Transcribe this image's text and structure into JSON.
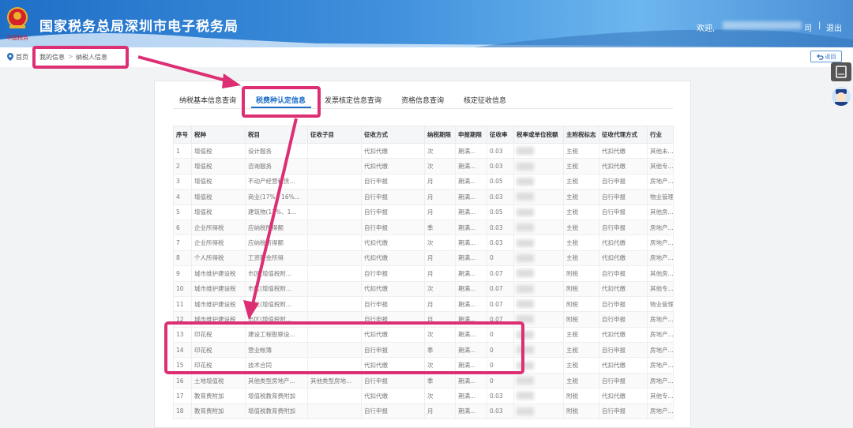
{
  "header": {
    "title": "国家税务总局深圳市电子税务局",
    "welcome": "欢迎,",
    "user_suffix": "司",
    "separator": "|",
    "logout": "退出",
    "logo_text": "中国税务"
  },
  "breadcrumb": {
    "home": "首页",
    "items": [
      "我的信息",
      "纳税人信息"
    ],
    "separator": ">"
  },
  "back_label": "返回",
  "tabs": [
    {
      "label": "纳税基本信息查询"
    },
    {
      "label": "税费种认定信息"
    },
    {
      "label": "发票核定信息查询"
    },
    {
      "label": "资格信息查询"
    },
    {
      "label": "核定征收信息"
    }
  ],
  "table": {
    "headers": [
      "序号",
      "税种",
      "税目",
      "征收子目",
      "征收方式",
      "纳税期限",
      "申报期限",
      "征收率",
      "税率或单位税额",
      "主附税标志",
      "征收代理方式",
      "行业"
    ],
    "rows": [
      [
        "1",
        "增值税",
        "设计服务",
        "",
        "代扣代缴",
        "次",
        "期满...",
        "0.03",
        "",
        "主税",
        "代扣代缴",
        "其他未..."
      ],
      [
        "2",
        "增值税",
        "咨询服务",
        "",
        "代扣代缴",
        "次",
        "期满...",
        "0.03",
        "",
        "主税",
        "代扣代缴",
        "其他专..."
      ],
      [
        "3",
        "增值税",
        "不动产经营租赁...",
        "",
        "自行申报",
        "月",
        "期满...",
        "0.05",
        "",
        "主税",
        "自行申报",
        "房地产..."
      ],
      [
        "4",
        "增值税",
        "商业(17%、16%...",
        "",
        "自行申报",
        "月",
        "期满...",
        "0.03",
        "",
        "主税",
        "自行申报",
        "物业管理"
      ],
      [
        "5",
        "增值税",
        "建筑物(11%、1...",
        "",
        "自行申报",
        "月",
        "期满...",
        "0.05",
        "",
        "主税",
        "自行申报",
        "其他房..."
      ],
      [
        "6",
        "企业所得税",
        "应纳税所得额",
        "",
        "自行申报",
        "季",
        "期满...",
        "0.03",
        "",
        "主税",
        "自行申报",
        "房地产..."
      ],
      [
        "7",
        "企业所得税",
        "应纳税所得额",
        "",
        "代扣代缴",
        "次",
        "期满...",
        "0.03",
        "",
        "主税",
        "代扣代缴",
        "房地产..."
      ],
      [
        "8",
        "个人所得税",
        "工资薪金所得",
        "",
        "代扣代缴",
        "月",
        "期满...",
        "0",
        "",
        "主税",
        "代扣代缴",
        "房地产..."
      ],
      [
        "9",
        "城市维护建设税",
        "市区(增值税附...",
        "",
        "自行申报",
        "月",
        "期满...",
        "0.07",
        "",
        "附税",
        "自行申报",
        "其他房..."
      ],
      [
        "10",
        "城市维护建设税",
        "市区(增值税附...",
        "",
        "代扣代缴",
        "次",
        "期满...",
        "0.07",
        "",
        "附税",
        "代扣代缴",
        "其他专..."
      ],
      [
        "11",
        "城市维护建设税",
        "市区(增值税附...",
        "",
        "自行申报",
        "月",
        "期满...",
        "0.07",
        "",
        "附税",
        "自行申报",
        "物业管理"
      ],
      [
        "12",
        "城市维护建设税",
        "市区(增值税附...",
        "",
        "自行申报",
        "月",
        "期满...",
        "0.07",
        "",
        "附税",
        "自行申报",
        "房地产..."
      ],
      [
        "13",
        "印花税",
        "建设工程勘察设...",
        "",
        "代扣代缴",
        "次",
        "期满...",
        "0",
        "",
        "主税",
        "代扣代缴",
        "房地产..."
      ],
      [
        "14",
        "印花税",
        "营业帐簿",
        "",
        "自行申报",
        "季",
        "期满...",
        "0",
        "",
        "主税",
        "自行申报",
        "房地产..."
      ],
      [
        "15",
        "印花税",
        "技术合同",
        "",
        "代扣代缴",
        "次",
        "期满...",
        "0",
        "",
        "主税",
        "代扣代缴",
        "房地产..."
      ],
      [
        "16",
        "土地增值税",
        "其他类型房地产...",
        "其他类型房地...",
        "自行申报",
        "季",
        "期满...",
        "0",
        "",
        "主税",
        "自行申报",
        "房地产..."
      ],
      [
        "17",
        "教育费附加",
        "增值税教育费附加",
        "",
        "代扣代缴",
        "次",
        "期满...",
        "0.03",
        "",
        "附税",
        "代扣代缴",
        "其他专..."
      ],
      [
        "18",
        "教育费附加",
        "增值税教育费附加",
        "",
        "自行申报",
        "月",
        "期满...",
        "0.03",
        "",
        "附税",
        "自行申报",
        "房地产..."
      ]
    ]
  },
  "annotation_color": "#dc2f74"
}
